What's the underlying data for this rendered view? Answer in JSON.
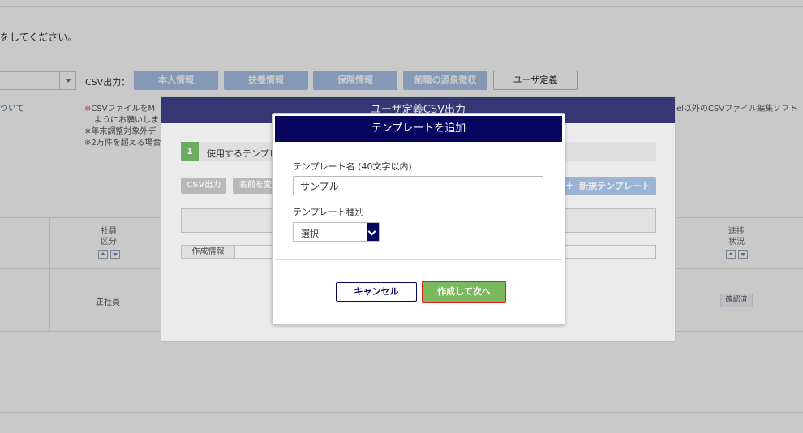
{
  "background": {
    "instruction_text": "をしてください。",
    "csv_label": "CSV出力：",
    "csv_buttons": [
      "本人情報",
      "扶養情報",
      "保険情報",
      "前職の源泉徴収",
      "ユーザ定義"
    ],
    "side_link": "ついて",
    "notes": [
      "※CSVファイルをM",
      "ようにお願いしま",
      "※年末調整対象外デ",
      "※2万件を超える場合"
    ],
    "right_note": "el以外のCSVファイル編集ソフト",
    "columns": {
      "employee_type": {
        "line1": "社員",
        "line2": "区分"
      },
      "progress": {
        "line1": "進捗",
        "line2": "状況"
      }
    },
    "row": {
      "employee_type_value": "正社員",
      "status_value": "確認済"
    }
  },
  "csv_modal": {
    "title": "ユーザ定義CSV出力",
    "step_number": "1",
    "step_text": "使用するテンプレ",
    "buttons": {
      "csv_output": "CSV出力",
      "rename": "名前を変"
    },
    "new_template_label": "新規テンプレート",
    "info_label": "作成情報"
  },
  "add_modal": {
    "title": "テンプレートを追加",
    "name_label": "テンプレート名 (40文字以内)",
    "name_value": "サンプル",
    "type_label": "テンプレート種別",
    "type_value": "選択",
    "cancel_label": "キャンセル",
    "create_label": "作成して次へ"
  },
  "colors": {
    "modal_header": "#06065f",
    "csv_modal_header": "#3d3c80",
    "primary_green": "#7cb85d",
    "highlight_red": "#e0201f",
    "light_blue_button": "#a9c3e8"
  },
  "icons": {
    "select_caret": "chevron-down-icon",
    "sort_up": "arrow-up-icon",
    "sort_down": "arrow-down-icon",
    "plus": "plus-icon"
  }
}
